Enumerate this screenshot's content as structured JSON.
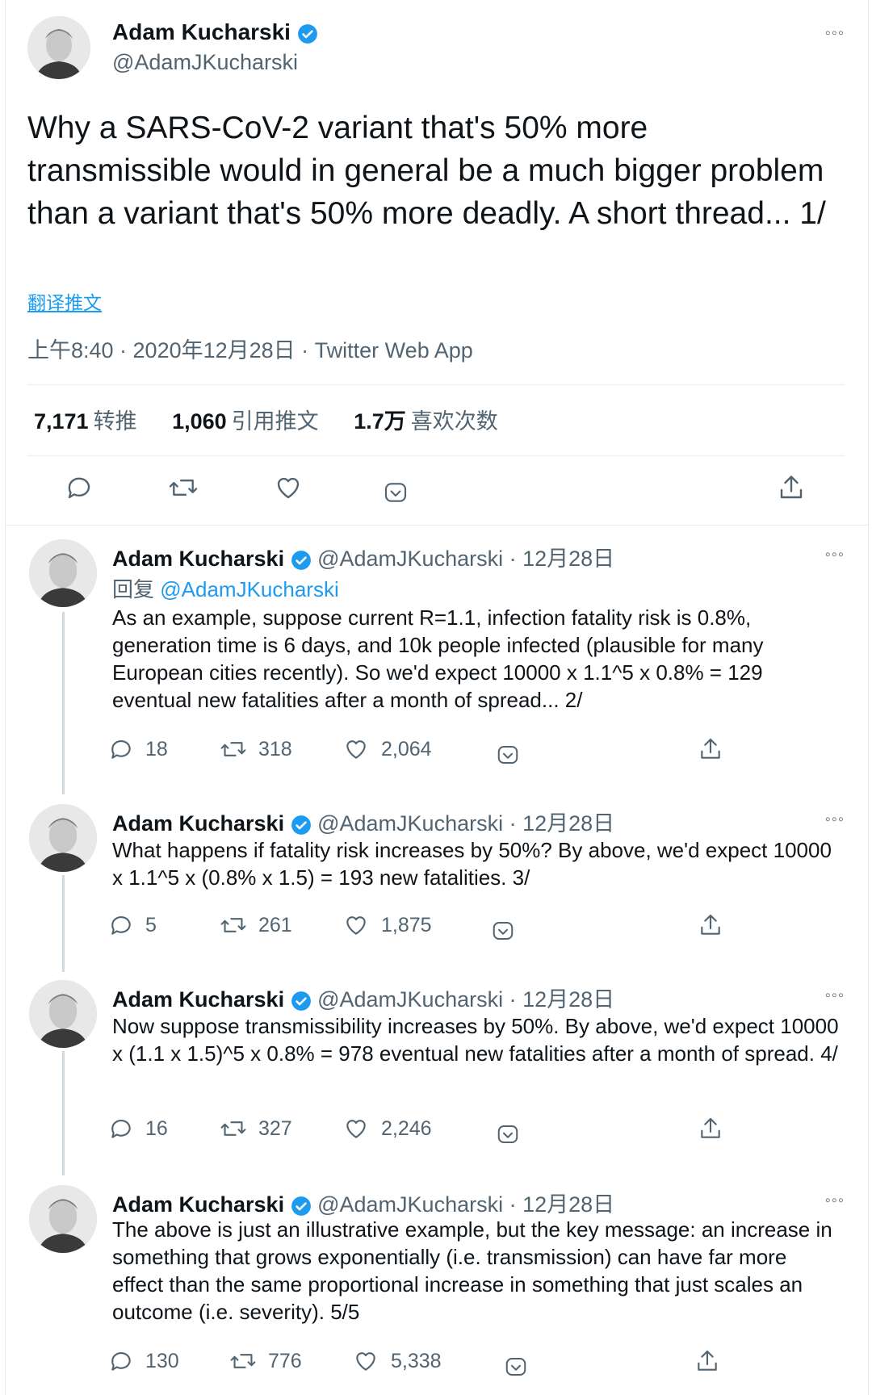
{
  "main": {
    "author": "Adam Kucharski",
    "handle": "@AdamJKucharski",
    "more": "◦◦◦",
    "text": "Why a SARS-CoV-2 variant that's 50% more transmissible would in general be a much bigger problem than a variant that's 50% more deadly. A short thread... 1/",
    "translate": "翻译推文",
    "meta": "上午8:40 · 2020年12月28日 · Twitter Web App",
    "retweets_num": "7,171",
    "retweets_label": "转推",
    "quotes_num": "1,060",
    "quotes_label": "引用推文",
    "likes_num": "1.7万",
    "likes_label": "喜欢次数"
  },
  "replies": [
    {
      "author": "Adam Kucharski",
      "meta": "@AdamJKucharski · 12月28日",
      "reply_prefix": "回复",
      "reply_to": "@AdamJKucharski",
      "text": "As an example, suppose current R=1.1, infection fatality risk is 0.8%, generation time is 6 days, and 10k people infected (plausible for many European cities recently). So we'd expect 10000 x 1.1^5 x 0.8% = 129 eventual new fatalities after a month of spread... 2/",
      "replies": "18",
      "retweets": "318",
      "likes": "2,064"
    },
    {
      "author": "Adam Kucharski",
      "meta": "@AdamJKucharski · 12月28日",
      "text": "What happens if fatality risk increases by 50%? By above, we'd expect 10000 x 1.1^5 x (0.8% x 1.5) = 193 new fatalities. 3/",
      "replies": "5",
      "retweets": "261",
      "likes": "1,875"
    },
    {
      "author": "Adam Kucharski",
      "meta": "@AdamJKucharski · 12月28日",
      "text": "Now suppose transmissibility increases by 50%. By above, we'd expect 10000 x (1.1 x 1.5)^5 x 0.8% = 978 eventual new fatalities after a month of spread. 4/",
      "replies": "16",
      "retweets": "327",
      "likes": "2,246"
    },
    {
      "author": "Adam Kucharski",
      "meta": "@AdamJKucharski · 12月28日",
      "text": "The above is just an illustrative example, but the key message: an increase in something that grows exponentially (i.e. transmission) can have far more effect than the same proportional increase in something that just scales an outcome (i.e. severity). 5/5",
      "replies": "130",
      "retweets": "776",
      "likes": "5,338"
    }
  ],
  "colors": {
    "verified": "#1d9bf0",
    "text": "#0f1419",
    "muted": "#536471",
    "border": "#e6ecf0"
  },
  "icons": [
    "verified-badge-icon",
    "more-icon",
    "reply-icon",
    "retweet-icon",
    "like-icon",
    "bookmark-icon",
    "share-icon"
  ]
}
